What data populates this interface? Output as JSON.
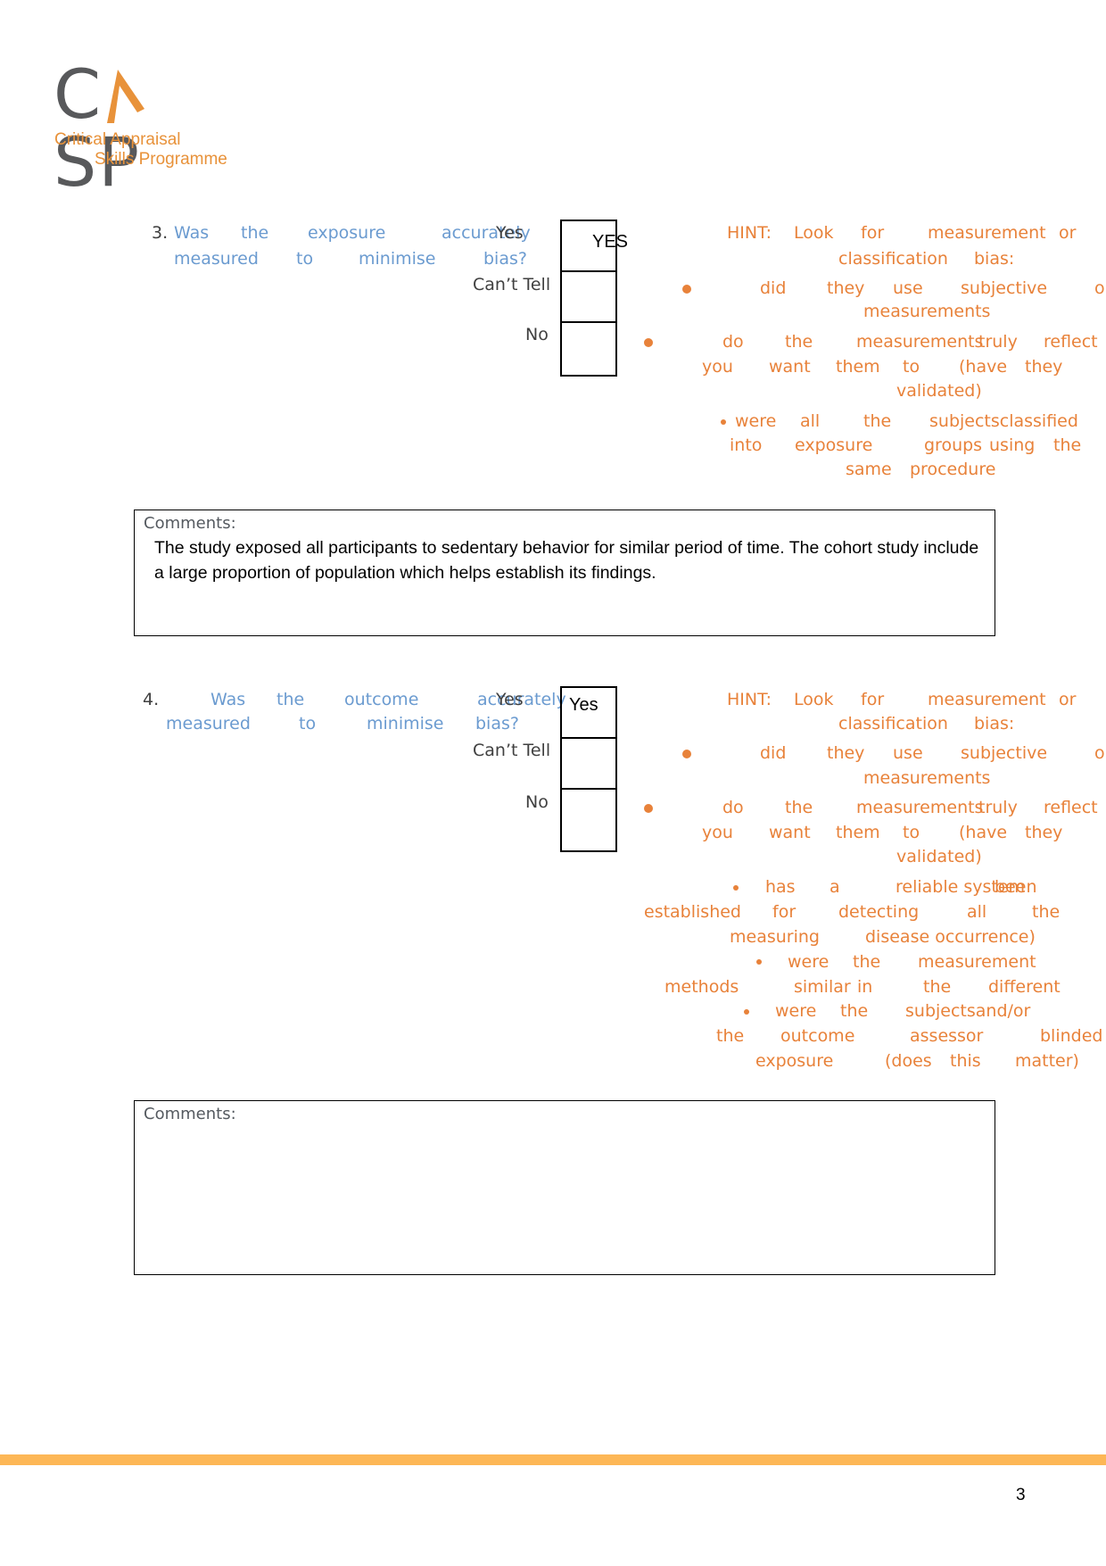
{
  "logo": {
    "mark_left": "C",
    "mark_right": "SP",
    "subtitle_line1": "Critical Appraisal",
    "subtitle_line2": "Skills Programme",
    "colors": {
      "grey": "#58595b",
      "orange": "#e8923a"
    }
  },
  "questions": [
    {
      "number": "3.",
      "text_line1_words": [
        "Was",
        "the",
        "exposure",
        "accurately"
      ],
      "text_line2_words": [
        "measured",
        "to",
        "minimise",
        "bias?"
      ],
      "full_text": "Was the exposure accurately measured to minimise bias?",
      "options": {
        "yes": "Yes",
        "cant_tell": "Can’t Tell",
        "no": "No"
      },
      "answers": {
        "yes": "YES",
        "cant_tell": "",
        "no": ""
      },
      "hint": {
        "intro_line1_words": [
          "HINT:",
          "Look",
          "for",
          "measurement",
          "or"
        ],
        "intro_line2_words": [
          "classification",
          "bias:"
        ],
        "bullets": [
          {
            "lines": [
              [
                "did",
                "they",
                "use",
                "subjective",
                "o"
              ],
              [
                "measurements"
              ]
            ]
          },
          {
            "lines": [
              [
                "do",
                "the",
                "measurements",
                "truly",
                "reflect"
              ],
              [
                "you",
                "want",
                "them",
                "to",
                "(have",
                "they"
              ],
              [
                "validated)"
              ]
            ]
          },
          {
            "lines": [
              [
                "were",
                "all",
                "the",
                "subjectsclassified"
              ],
              [
                "into",
                "exposure",
                "groups",
                "using",
                "the"
              ],
              [
                "same",
                "procedure"
              ]
            ]
          }
        ]
      },
      "comments": {
        "label": "Comments:",
        "text": "The study exposed all participants to sedentary behavior for similar period of time. The cohort study include  a large proportion of population which helps establish its findings."
      }
    },
    {
      "number": "4.",
      "text_line1_words": [
        "Was",
        "the",
        "outcome",
        "accurately"
      ],
      "text_line2_words": [
        "measured",
        "to",
        "minimise",
        "bias?"
      ],
      "full_text": "Was the outcome accurately measured to minimise bias?",
      "options": {
        "yes": "Yes",
        "cant_tell": "Can’t Tell",
        "no": "No"
      },
      "answers": {
        "yes": "Yes",
        "cant_tell": "",
        "no": ""
      },
      "hint": {
        "intro_line1_words": [
          "HINT:",
          "Look",
          "for",
          "measurement",
          "or"
        ],
        "intro_line2_words": [
          "classification",
          "bias:"
        ],
        "bullets": [
          {
            "lines": [
              [
                "did",
                "they",
                "use",
                "subjective",
                "o"
              ],
              [
                "measurements"
              ]
            ]
          },
          {
            "lines": [
              [
                "do",
                "the",
                "measurements",
                "truly",
                "reflect"
              ],
              [
                "you",
                "want",
                "them",
                "to",
                "(have",
                "they"
              ],
              [
                "validated)"
              ]
            ]
          },
          {
            "lines": [
              [
                "has",
                "a",
                "reliable system",
                "been"
              ],
              [
                "established",
                "for",
                "detecting",
                "all",
                "the"
              ],
              [
                "measuring",
                "disease occurrence)"
              ]
            ]
          },
          {
            "lines": [
              [
                "were",
                "the",
                "measurement"
              ],
              [
                "methods",
                "similar",
                "in",
                "the",
                "different"
              ]
            ]
          },
          {
            "lines": [
              [
                "were",
                "the",
                "subjectsand/or"
              ],
              [
                "the",
                "outcome",
                "assessor",
                "blinded"
              ],
              [
                "exposure",
                "(does",
                "this",
                "matter)"
              ]
            ]
          }
        ]
      },
      "comments": {
        "label": "Comments:",
        "text": ""
      }
    }
  ],
  "footer": {
    "page_number": "3",
    "bar_color": "#fdb756"
  }
}
